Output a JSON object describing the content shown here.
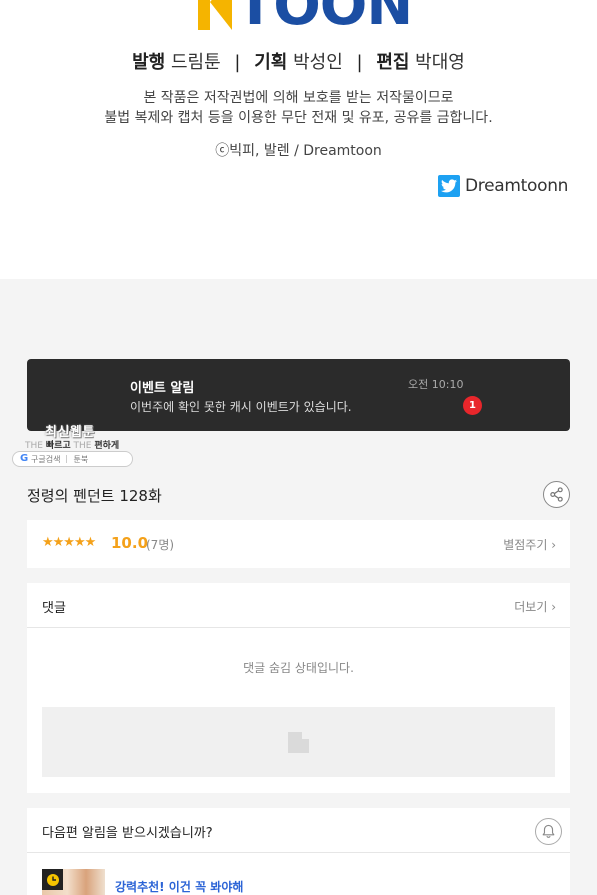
{
  "credits": {
    "logo_text": "TOON",
    "publisher_label": "발행",
    "publisher_value": "드림툰",
    "planner_label": "기획",
    "planner_value": "박성인",
    "editor_label": "편집",
    "editor_value": "박대영",
    "separator": "|",
    "copyright_notice_1": "본 작품은 저작권법에 의해 보호를 받는 저작물이므로",
    "copyright_notice_2": "불법 복제와 캡처 등을 이용한 무단 전재 및 유포, 공유를 금합니다.",
    "copyright_line": "ⓒ빅피, 발렌 / Dreamtoon",
    "twitter_handle": "Dreamtoonn"
  },
  "event_toast": {
    "title": "이벤트 알림",
    "body": "이번주에 확인 못한 캐시 이벤트가 있습니다.",
    "time": "오전 10:10",
    "badge": "1"
  },
  "mini_ad": {
    "title": "최신웹툰",
    "sub_dim_1": "THE",
    "sub_bold_1": "빠르고",
    "sub_dim_2": "THE",
    "sub_bold_2": "편하게",
    "pill_left": "구글검색",
    "pill_right": "툰북"
  },
  "episode": {
    "title": "정령의 펜던트 128화"
  },
  "rating": {
    "stars": "★★★★★",
    "score": "10.0",
    "count": "(7명)",
    "rate_link": "별점주기 ›"
  },
  "comments": {
    "label": "댓글",
    "more_link": "더보기 ›",
    "hidden_message": "댓글 숨김 상태입니다."
  },
  "notify": {
    "label": "다음편 알림을 받으시겠습니까?",
    "recommend_text": "강력추천! 이건 꼭 봐야해"
  },
  "colors": {
    "brand_blue": "#1b4ea3",
    "brand_yellow": "#f5b400",
    "rating_orange": "#f4a11a",
    "badge_red": "#e8262b",
    "link_blue": "#2c64d6",
    "twitter_blue": "#1da1f2"
  }
}
